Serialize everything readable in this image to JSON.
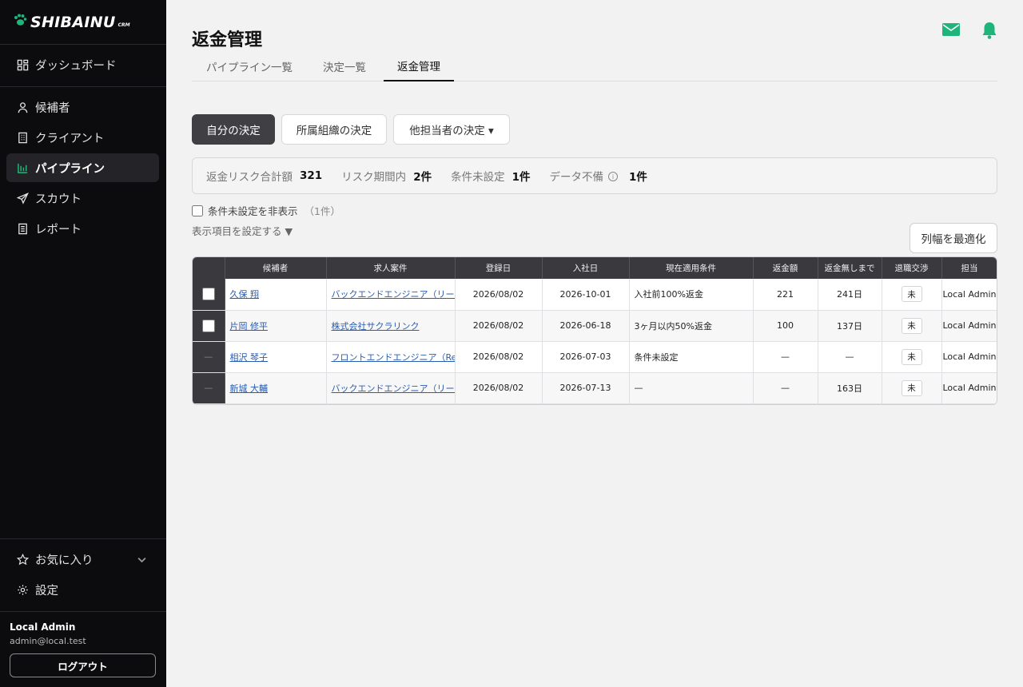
{
  "brand": {
    "name": "SHIBAINU",
    "suffix": "CRM"
  },
  "sidebar": {
    "items": [
      {
        "label": "ダッシュボード"
      },
      {
        "label": "候補者"
      },
      {
        "label": "クライアント"
      },
      {
        "label": "パイプライン"
      },
      {
        "label": "スカウト"
      },
      {
        "label": "レポート"
      }
    ],
    "favorites_label": "お気に入り",
    "settings_label": "設定",
    "user": {
      "name": "Local Admin",
      "email": "admin@local.test"
    },
    "logout_label": "ログアウト"
  },
  "header": {
    "title": "返金管理",
    "tabs": [
      "パイプライン一覧",
      "決定一覧",
      "返金管理"
    ],
    "active_tab": "返金管理"
  },
  "filters": [
    "自分の決定",
    "所属組織の決定",
    "他担当者の決定 ▾"
  ],
  "summary": {
    "total_label": "返金リスク合計額",
    "total_value": "321",
    "period_label": "リスク期間内",
    "period_value": "2件",
    "unset_label": "条件未設定",
    "unset_value": "1件",
    "missing_label": "データ不備",
    "missing_value": "1件"
  },
  "options": {
    "hide_unset_label": "条件未設定を非表示",
    "hide_unset_count": "（1件）",
    "column_settings_label": "表示項目を設定する ▼",
    "fit_columns_label": "列幅を最適化"
  },
  "table": {
    "headers": [
      "",
      "候補者",
      "求人案件",
      "登録日",
      "入社日",
      "現在適用条件",
      "返金額",
      "返金無しまで",
      "退職交渉",
      "担当"
    ],
    "rows": [
      {
        "candidate": "久保 翔",
        "job": "バックエンドエンジニア（リード）",
        "registered": "2026/08/02",
        "joined": "2026-10-01",
        "condition": "入社前100%返金",
        "amount": "221",
        "remaining": "241日",
        "negotiation": "未",
        "owner": "Local Admin"
      },
      {
        "candidate": "片岡 修平",
        "job": "株式会社サクラリンク",
        "registered": "2026/08/02",
        "joined": "2026-06-18",
        "condition": "3ヶ月以内50%返金",
        "amount": "100",
        "remaining": "137日",
        "negotiation": "未",
        "owner": "Local Admin"
      },
      {
        "candidate": "相沢 琴子",
        "job": "フロントエンドエンジニア（React）",
        "registered": "2026/08/02",
        "joined": "2026-07-03",
        "condition": "条件未設定",
        "amount": "—",
        "remaining": "—",
        "negotiation": "未",
        "owner": "Local Admin"
      },
      {
        "candidate": "新城 大輔",
        "job": "バックエンドエンジニア（リード）",
        "registered": "2026/08/02",
        "joined": "2026-07-13",
        "condition": "—",
        "amount": "—",
        "remaining": "163日",
        "negotiation": "未",
        "owner": "Local Admin"
      }
    ],
    "selectable": [
      true,
      true,
      false,
      false
    ],
    "disabled_mark": "—"
  },
  "colors": {
    "accent": "#1fb57a",
    "sidebar_bg": "#0c0c0e",
    "table_header": "#3a3a3e"
  }
}
